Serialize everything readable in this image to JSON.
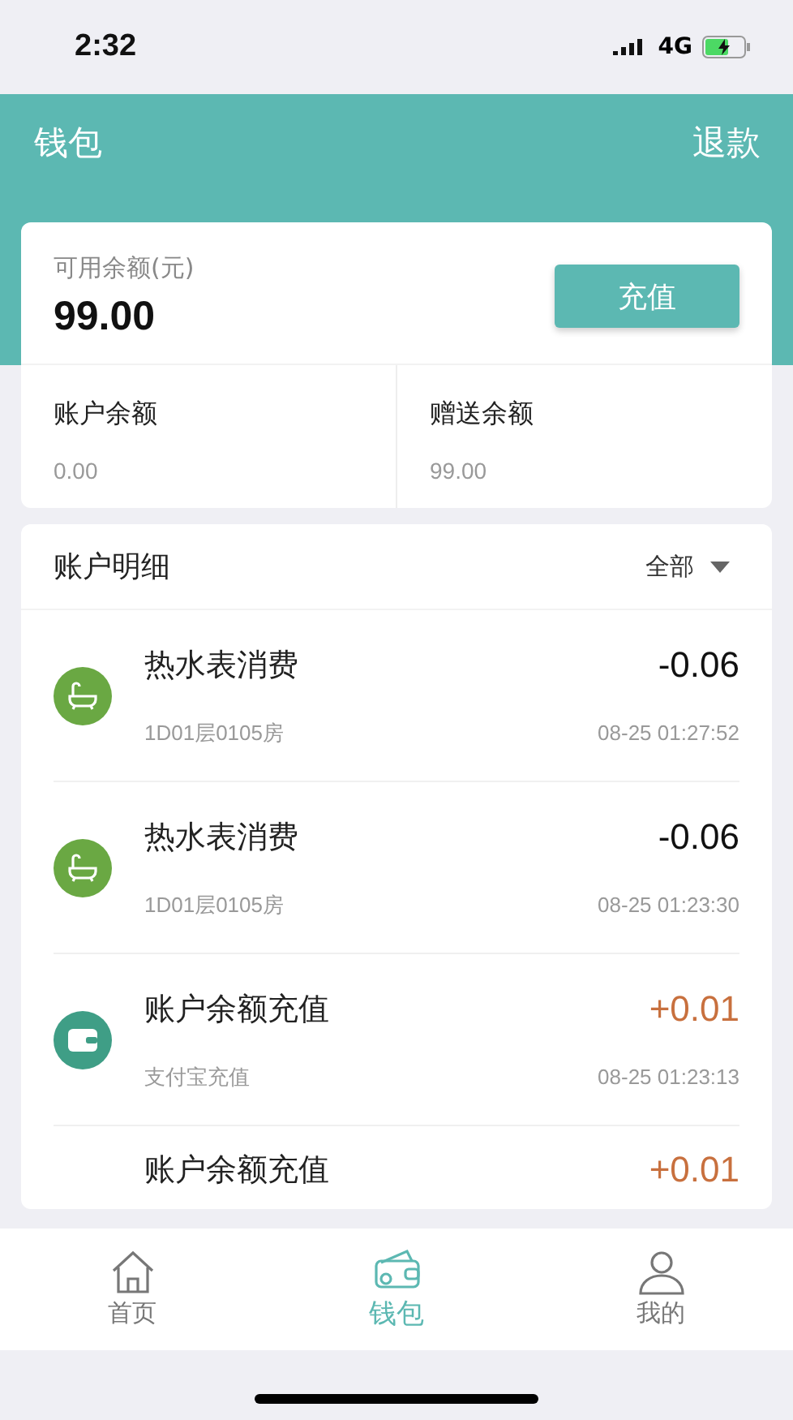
{
  "status_bar": {
    "time": "2:32",
    "network": "4G"
  },
  "header": {
    "title": "钱包",
    "action": "退款"
  },
  "balance": {
    "label": "可用余额(元)",
    "amount": "99.00",
    "button": "充值",
    "parts": [
      {
        "label": "账户余额",
        "value": "0.00"
      },
      {
        "label": "赠送余额",
        "value": "99.00"
      }
    ]
  },
  "details": {
    "title": "账户明细",
    "filter": "全部",
    "items": [
      {
        "kind": "expense",
        "title": "热水表消费",
        "amount": "-0.06",
        "subtitle": "1D01层0105房",
        "time": "08-25 01:27:52"
      },
      {
        "kind": "expense",
        "title": "热水表消费",
        "amount": "-0.06",
        "subtitle": "1D01层0105房",
        "time": "08-25 01:23:30"
      },
      {
        "kind": "income",
        "title": "账户余额充值",
        "amount": "+0.01",
        "subtitle": "支付宝充值",
        "time": "08-25 01:23:13"
      },
      {
        "kind": "income",
        "title": "账户余额充值",
        "amount": "+0.01"
      }
    ]
  },
  "tab_bar": [
    {
      "kind": "home",
      "label": "首页",
      "selected": false
    },
    {
      "kind": "wallet",
      "label": "钱包",
      "selected": true
    },
    {
      "kind": "user",
      "label": "我的",
      "selected": false
    }
  ]
}
